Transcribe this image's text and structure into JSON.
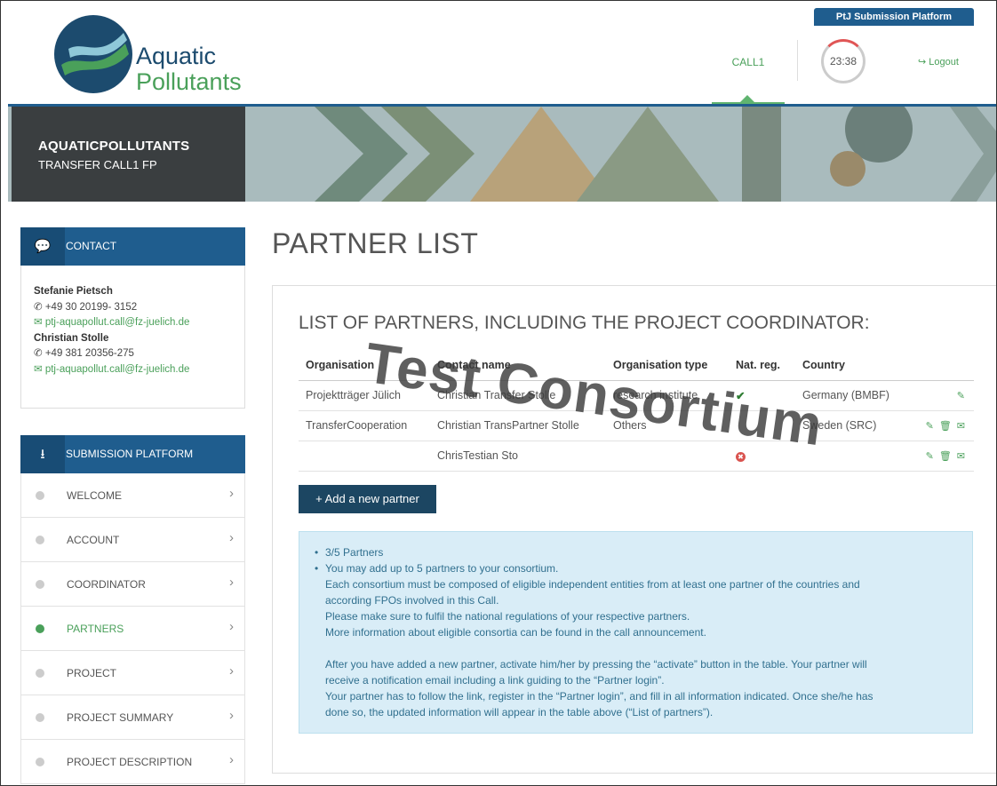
{
  "header": {
    "logo_line1": "Aquatic",
    "logo_line2": "Pollutants",
    "platform_tab": "PtJ Submission Platform",
    "nav_call": "CALL1",
    "timer": "23:38",
    "logout": "Logout"
  },
  "banner": {
    "title": "AQUATICPOLLUTANTS",
    "subtitle": "TRANSFER CALL1 FP"
  },
  "contact": {
    "heading": "CONTACT",
    "persons": [
      {
        "name": "Stefanie Pietsch",
        "phone": "+49 30 20199- 3152",
        "email": "ptj-aquapollut.call@fz-juelich.de"
      },
      {
        "name": "Christian Stolle",
        "phone": "+49 381 20356-275",
        "email": "ptj-aquapollut.call@fz-juelich.de"
      }
    ]
  },
  "submission": {
    "heading": "SUBMISSION PLATFORM",
    "items": [
      {
        "label": "WELCOME",
        "active": false
      },
      {
        "label": "ACCOUNT",
        "active": false
      },
      {
        "label": "COORDINATOR",
        "active": false
      },
      {
        "label": "PARTNERS",
        "active": true
      },
      {
        "label": "PROJECT",
        "active": false
      },
      {
        "label": "PROJECT SUMMARY",
        "active": false
      },
      {
        "label": "PROJECT DESCRIPTION",
        "active": false
      }
    ]
  },
  "main": {
    "page_title": "PARTNER LIST",
    "list_title": "LIST OF PARTNERS, INCLUDING THE PROJECT COORDINATOR:",
    "columns": [
      "Organisation",
      "Contact name",
      "Organisation type",
      "Nat. reg.",
      "Country"
    ],
    "rows": [
      {
        "organisation": "Projektträger Jülich",
        "contact": "Christian Transfer Stolle",
        "type": "research institute",
        "natreg": "ok",
        "country": "Germany (BMBF)"
      },
      {
        "organisation": "TransferCooperation",
        "contact": "Christian TransPartner Stolle",
        "type": "Others",
        "natreg": "",
        "country": "Sweden (SRC)"
      },
      {
        "organisation": "",
        "contact": "ChrisTestian Sto",
        "type": "",
        "natreg": "missing",
        "country": ""
      }
    ],
    "add_button": "+ Add a new partner",
    "info": {
      "bullet1": "3/5 Partners",
      "bullet2": "You may add up to 5 partners to your consortium.",
      "p1": "Each consortium must be composed of eligible independent entities from at least one partner of the countries and",
      "p2": "according FPOs involved in this Call.",
      "p3": "Please make sure to fulfil the national regulations of your respective partners.",
      "p4": "More information about eligible consortia can be found in the call announcement.",
      "p5": "After you have added a new partner, activate him/her by pressing the “activate” button in the table. Your partner will",
      "p6": "receive a notification email including a link guiding to the “Partner login”.",
      "p7": "Your partner has to follow the link, register in the “Partner login”, and fill in all information indicated. Once she/he has",
      "p8": "done so, the updated information will appear in the table above (“List of partners”)."
    }
  },
  "watermark": "Test Consortium",
  "colors": {
    "primary": "#1f5d8e",
    "accent": "#4aa05a",
    "info_bg": "#d9edf7"
  }
}
